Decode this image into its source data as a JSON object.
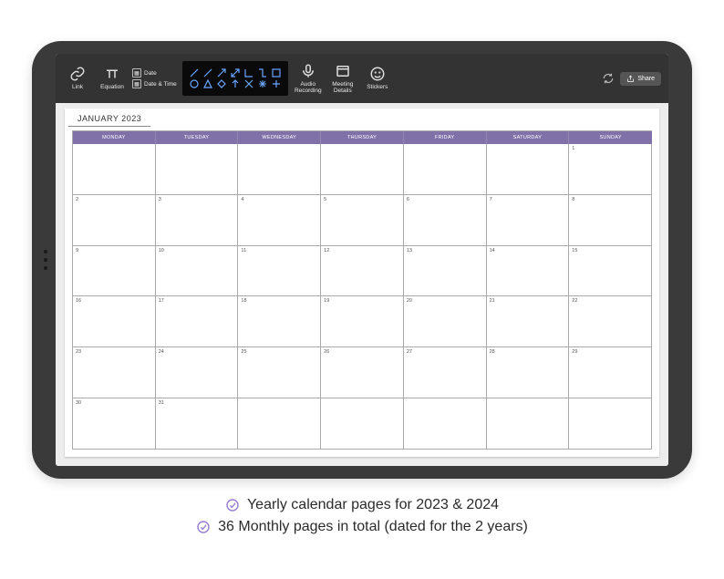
{
  "toolbar": {
    "link_label": "Link",
    "equation_label": "Equation",
    "date_label": "Date",
    "datetime_label": "Date & Time",
    "audio_label": "Audio\nRecording",
    "meeting_label": "Meeting\nDetails",
    "stickers_label": "Stickers",
    "share_label": "Share"
  },
  "calendar": {
    "month_title": "JANUARY 2023",
    "day_headers": [
      "MONDAY",
      "TUESDAY",
      "WEDNESDAY",
      "THURSDAY",
      "FRIDAY",
      "SATURDAY",
      "SUNDAY"
    ],
    "cells": [
      "",
      "",
      "",
      "",
      "",
      "",
      "1",
      "2",
      "3",
      "4",
      "5",
      "6",
      "7",
      "8",
      "9",
      "10",
      "11",
      "12",
      "13",
      "14",
      "15",
      "16",
      "17",
      "18",
      "19",
      "20",
      "21",
      "22",
      "23",
      "24",
      "25",
      "26",
      "27",
      "28",
      "29",
      "30",
      "31",
      "",
      "",
      "",
      "",
      ""
    ]
  },
  "bullets": {
    "line1": "Yearly calendar pages for 2023 & 2024",
    "line2": "36 Monthly pages in total (dated for the 2 years)"
  },
  "colors": {
    "accent_purple": "#8071a8",
    "check_purple": "#9b7fd4",
    "tablet_body": "#3a3a3a",
    "toolbar_bg": "#333333"
  }
}
